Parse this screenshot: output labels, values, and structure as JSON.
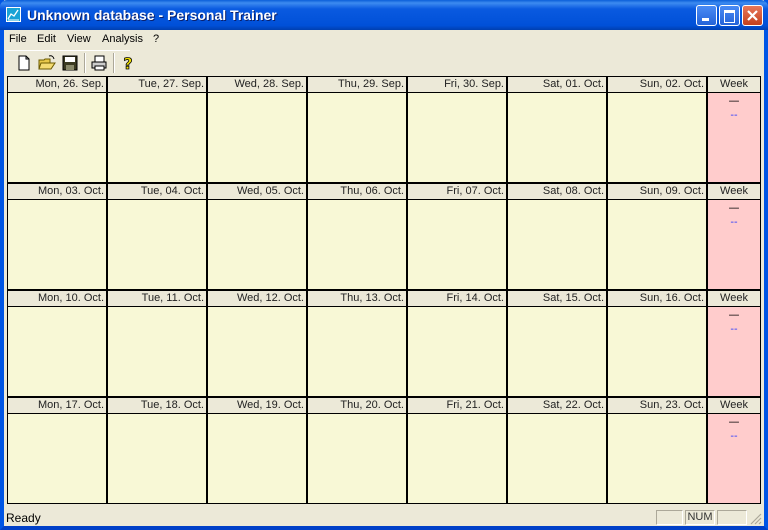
{
  "window": {
    "title": "Unknown database - Personal Trainer",
    "app_icon": "chart-icon",
    "controls": [
      "minimize",
      "maximize",
      "close"
    ]
  },
  "menubar": {
    "items": [
      {
        "label": "File"
      },
      {
        "label": "Edit"
      },
      {
        "label": "View"
      },
      {
        "label": "Analysis"
      },
      {
        "label": "?"
      }
    ]
  },
  "toolbar": {
    "buttons": [
      {
        "name": "new",
        "icon": "new-document-icon"
      },
      {
        "name": "open",
        "icon": "open-folder-icon"
      },
      {
        "name": "save",
        "icon": "save-disk-icon"
      },
      {
        "name": "print",
        "icon": "printer-icon"
      },
      {
        "name": "help",
        "icon": "help-question-icon"
      }
    ]
  },
  "calendar": {
    "week_label": "Week",
    "rows": [
      {
        "days": [
          "Mon, 26. Sep.",
          "Tue, 27. Sep.",
          "Wed, 28. Sep.",
          "Thu, 29. Sep.",
          "Fri, 30. Sep.",
          "Sat, 01. Oct.",
          "Sun, 02. Oct."
        ],
        "week_value1": "—",
        "week_value2": "--"
      },
      {
        "days": [
          "Mon, 03. Oct.",
          "Tue, 04. Oct.",
          "Wed, 05. Oct.",
          "Thu, 06. Oct.",
          "Fri, 07. Oct.",
          "Sat, 08. Oct.",
          "Sun, 09. Oct."
        ],
        "week_value1": "—",
        "week_value2": "--"
      },
      {
        "days": [
          "Mon, 10. Oct.",
          "Tue, 11. Oct.",
          "Wed, 12. Oct.",
          "Thu, 13. Oct.",
          "Fri, 14. Oct.",
          "Sat, 15. Oct.",
          "Sun, 16. Oct."
        ],
        "week_value1": "—",
        "week_value2": "--"
      },
      {
        "days": [
          "Mon, 17. Oct.",
          "Tue, 18. Oct.",
          "Wed, 19. Oct.",
          "Thu, 20. Oct.",
          "Fri, 21. Oct.",
          "Sat, 22. Oct.",
          "Sun, 23. Oct."
        ],
        "week_value1": "—",
        "week_value2": "--"
      }
    ],
    "colors": {
      "day_bg": "#f8f8d6",
      "week_bg": "#ffcccc",
      "week_value2_color": "#1e32ff"
    }
  },
  "statusbar": {
    "text": "Ready",
    "panes": [
      "",
      "NUM",
      ""
    ]
  }
}
